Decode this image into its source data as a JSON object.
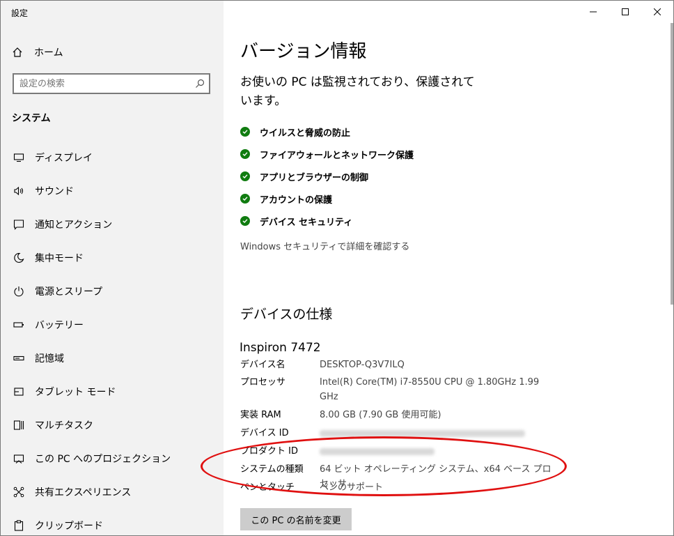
{
  "window": {
    "title": "設定"
  },
  "sidebar": {
    "home_label": "ホーム",
    "search_placeholder": "設定の検索",
    "section_heading": "システム",
    "items": [
      {
        "label": "ディスプレイ",
        "icon": "display-icon"
      },
      {
        "label": "サウンド",
        "icon": "sound-icon"
      },
      {
        "label": "通知とアクション",
        "icon": "notification-icon"
      },
      {
        "label": "集中モード",
        "icon": "moon-icon"
      },
      {
        "label": "電源とスリープ",
        "icon": "power-icon"
      },
      {
        "label": "バッテリー",
        "icon": "battery-icon"
      },
      {
        "label": "記憶域",
        "icon": "storage-icon"
      },
      {
        "label": "タブレット モード",
        "icon": "tablet-icon"
      },
      {
        "label": "マルチタスク",
        "icon": "multitask-icon"
      },
      {
        "label": "この PC へのプロジェクション",
        "icon": "projection-icon"
      },
      {
        "label": "共有エクスペリエンス",
        "icon": "share-icon"
      },
      {
        "label": "クリップボード",
        "icon": "clipboard-icon"
      }
    ]
  },
  "main": {
    "title": "バージョン情報",
    "protection_text": "お使いの PC は監視されており、保護されています。",
    "security_items": [
      "ウイルスと脅威の防止",
      "ファイアウォールとネットワーク保護",
      "アプリとブラウザーの制御",
      "アカウントの保護",
      "デバイス セキュリティ"
    ],
    "security_link": "Windows セキュリティで詳細を確認する",
    "device_spec_heading": "デバイスの仕様",
    "model": "Inspiron 7472",
    "specs": {
      "device_name": {
        "label": "デバイス名",
        "value": "DESKTOP-Q3V7ILQ"
      },
      "processor": {
        "label": "プロセッサ",
        "value": "Intel(R) Core(TM) i7-8550U CPU @ 1.80GHz 1.99 GHz"
      },
      "ram": {
        "label": "実装 RAM",
        "value": "8.00 GB (7.90 GB 使用可能)"
      },
      "device_id": {
        "label": "デバイス ID"
      },
      "product_id": {
        "label": "プロダクト ID"
      },
      "system_type": {
        "label": "システムの種類",
        "value": "64 ビット オペレーティング システム、x64 ベース プロセッサ"
      },
      "pen_touch": {
        "label": "ペンとタッチ",
        "value": "ペンのサポート"
      }
    },
    "rename_button": "この PC の名前を変更"
  },
  "colors": {
    "check_green": "#107c10",
    "highlight_ring": "#e01010",
    "sidebar_bg": "#f2f2f2"
  }
}
